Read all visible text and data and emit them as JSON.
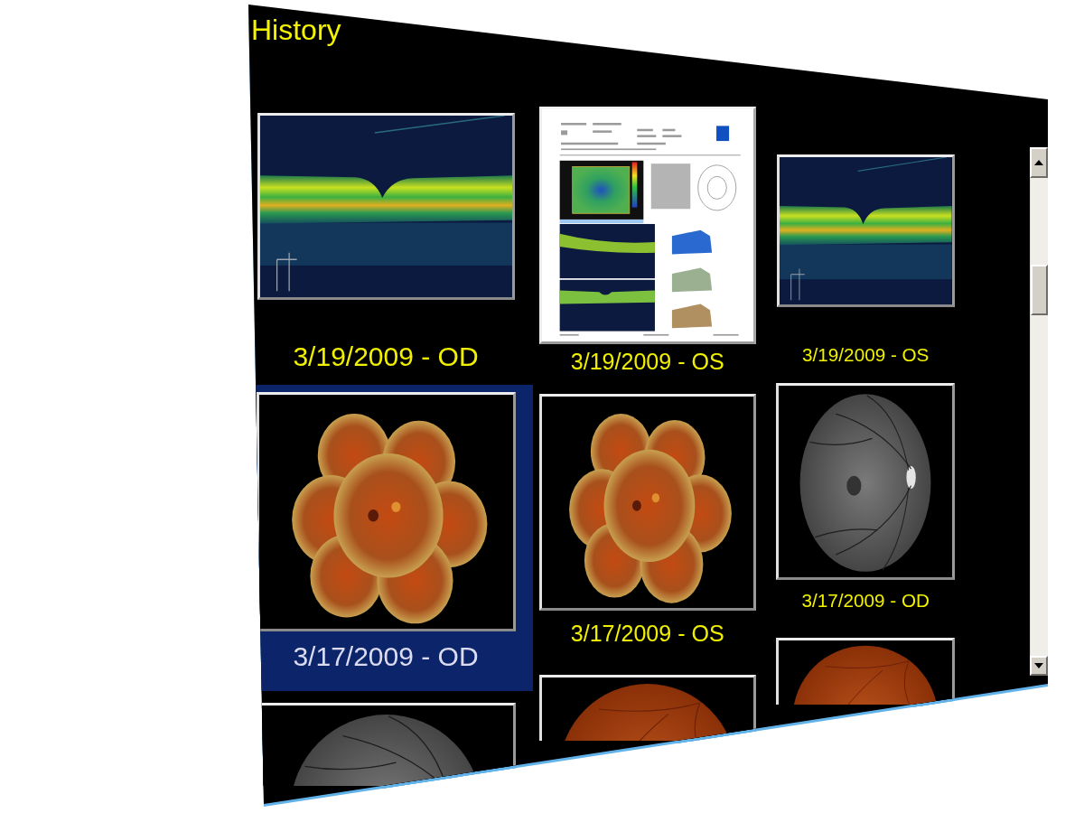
{
  "panel": {
    "title": "History"
  },
  "thumbnails": [
    {
      "kind": "oct",
      "caption": "3/19/2009 - OD",
      "selected": false
    },
    {
      "kind": "report",
      "caption": "3/19/2009 - OS",
      "selected": false
    },
    {
      "kind": "oct",
      "caption": "3/19/2009 - OS",
      "selected": false
    },
    {
      "kind": "mosaic",
      "caption": "3/17/2009 - OD",
      "selected": true
    },
    {
      "kind": "mosaic",
      "caption": "3/17/2009 - OS",
      "selected": false
    },
    {
      "kind": "gray-fundus",
      "caption": "3/17/2009 - OD",
      "selected": false
    },
    {
      "kind": "gray-fundus",
      "selected": false
    },
    {
      "kind": "color-fundus",
      "selected": false
    },
    {
      "kind": "color-fundus",
      "selected": false
    }
  ]
}
